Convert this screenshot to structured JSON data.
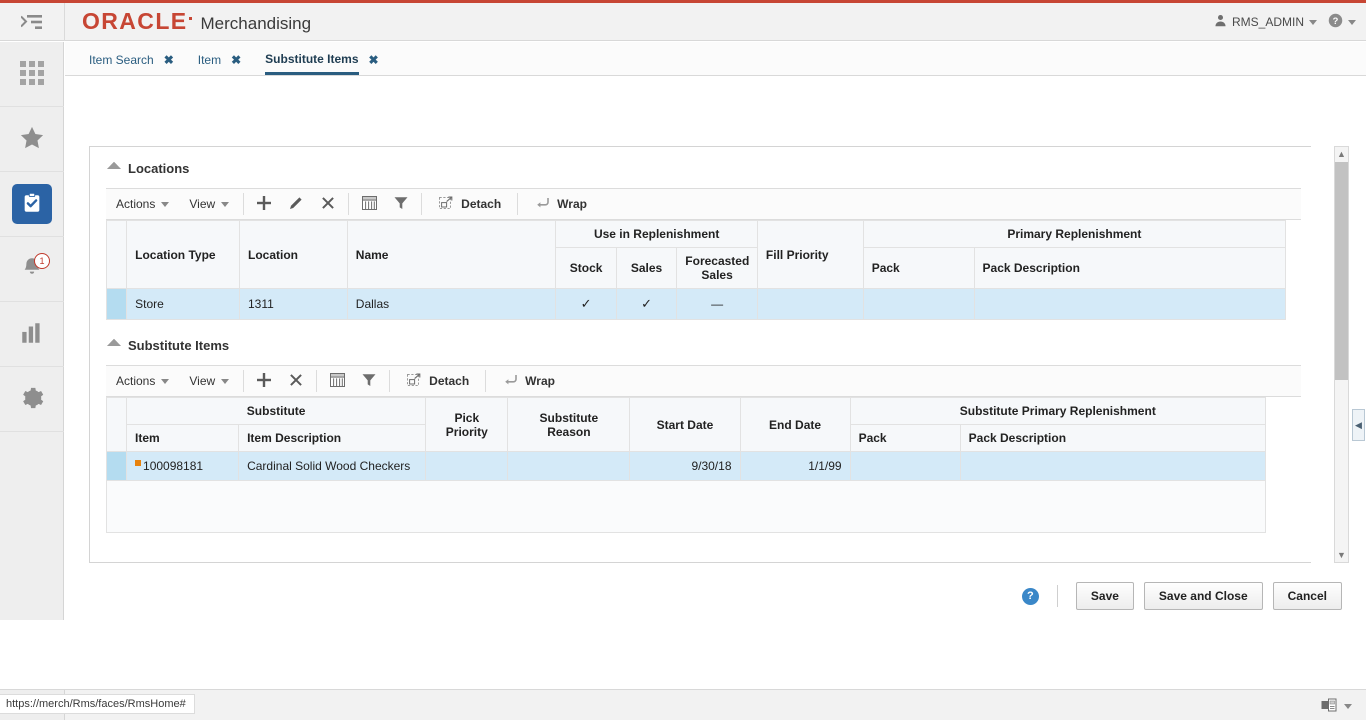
{
  "header": {
    "menu_toggle_icon": "collapse-menu-icon",
    "brand": "ORACLE",
    "app_title": "Merchandising",
    "user": "RMS_ADMIN",
    "user_icon": "user-icon",
    "help_icon": "help-icon",
    "accent_red": "#c74634"
  },
  "rail": {
    "items": [
      {
        "icon": "apps-grid-icon",
        "active": false
      },
      {
        "icon": "star-icon",
        "active": false
      },
      {
        "icon": "tasks-clipboard-icon",
        "active": true
      },
      {
        "icon": "notifications-bell-icon",
        "active": false,
        "badge": "1"
      },
      {
        "icon": "reports-bar-chart-icon",
        "active": false
      },
      {
        "icon": "settings-gear-icon",
        "active": false
      }
    ],
    "active_color": "#2b63a5",
    "badge_color": "#c0392b"
  },
  "tabs": [
    {
      "label": "Item Search",
      "selected": false,
      "close": "✖"
    },
    {
      "label": "Item",
      "selected": false,
      "close": "✖"
    },
    {
      "label": "Substitute Items",
      "selected": true,
      "close": "✖"
    }
  ],
  "locations": {
    "title": "Locations",
    "toolbar": {
      "actions_label": "Actions",
      "view_label": "View",
      "add_icon": "add-plus-icon",
      "edit_icon": "edit-pencil-icon",
      "delete_icon": "delete-x-icon",
      "export_icon": "export-spreadsheet-icon",
      "filter_icon": "filter-funnel-icon",
      "detach_label": "Detach",
      "detach_icon": "detach-icon",
      "wrap_label": "Wrap",
      "wrap_icon": "wrap-icon"
    },
    "group_headers": {
      "use_in_replenishment": "Use in Replenishment",
      "primary_replenishment": "Primary Replenishment"
    },
    "columns": [
      "Location Type",
      "Location",
      "Name",
      "Stock",
      "Sales",
      "Forecasted Sales",
      "Fill Priority",
      "Pack",
      "Pack Description"
    ],
    "rows": [
      {
        "location_type": "Store",
        "location": "1311",
        "name": "Dallas",
        "stock": "✓",
        "sales": "✓",
        "forecasted_sales": "—",
        "fill_priority": "",
        "pack": "",
        "pack_description": "",
        "selected": true
      }
    ]
  },
  "substitute_items": {
    "title": "Substitute Items",
    "toolbar": {
      "actions_label": "Actions",
      "view_label": "View",
      "add_icon": "add-plus-icon",
      "delete_icon": "delete-x-icon",
      "export_icon": "export-spreadsheet-icon",
      "filter_icon": "filter-funnel-icon",
      "detach_label": "Detach",
      "detach_icon": "detach-icon",
      "wrap_label": "Wrap",
      "wrap_icon": "wrap-icon"
    },
    "group_headers": {
      "substitute": "Substitute",
      "substitute_primary_replenishment": "Substitute Primary Replenishment"
    },
    "columns": [
      "Item",
      "Item Description",
      "Pick Priority",
      "Substitute Reason",
      "Start Date",
      "End Date",
      "Pack",
      "Pack Description"
    ],
    "rows": [
      {
        "item": "100098181",
        "item_description": "Cardinal Solid Wood Checkers",
        "pick_priority": "",
        "substitute_reason": "",
        "start_date": "9/30/18",
        "end_date": "1/1/99",
        "pack": "",
        "pack_description": "",
        "selected": true,
        "changed": true
      }
    ]
  },
  "footer": {
    "help_icon": "help-question-icon",
    "help_glyph": "?",
    "save_label": "Save",
    "save_and_close_label": "Save and Close",
    "cancel_label": "Cancel"
  },
  "statusbar": {
    "url": "https://merch/Rms/faces/RmsHome#",
    "device_icon": "printer-device-icon"
  },
  "scrollbar": {
    "up_glyph": "▲",
    "down_glyph": "▼",
    "handle_glyph": "◀"
  }
}
